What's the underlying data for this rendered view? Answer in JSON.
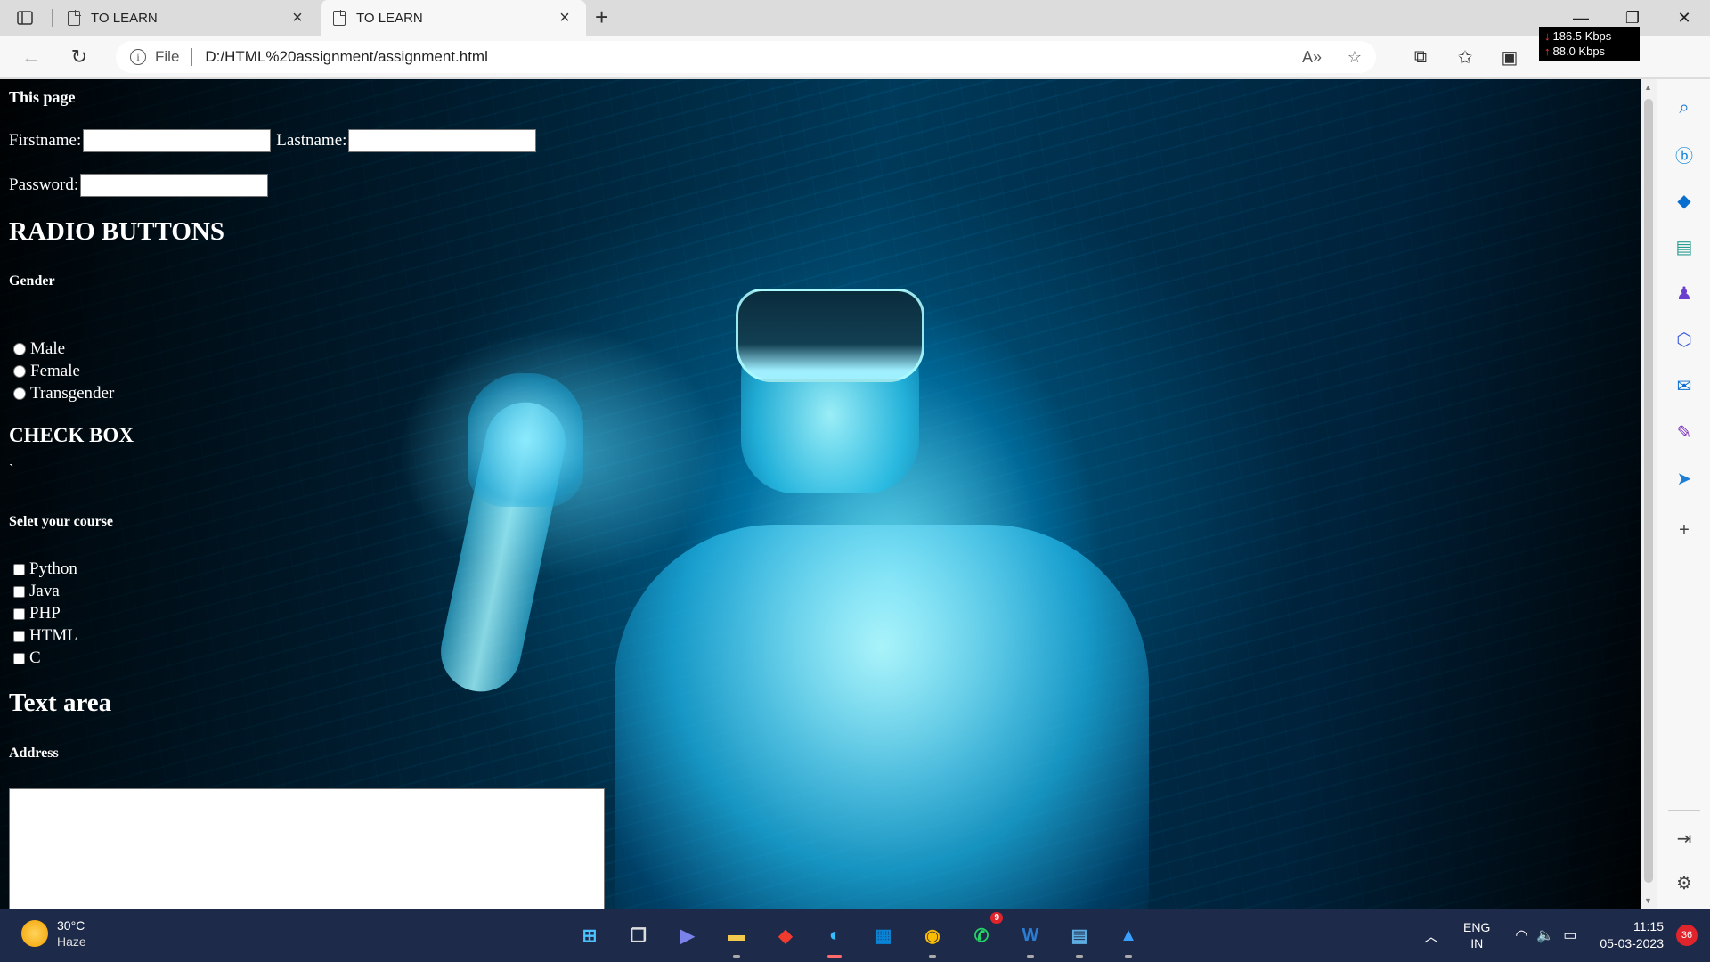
{
  "browser": {
    "tabs": [
      {
        "title": "TO LEARN",
        "active": false
      },
      {
        "title": "TO LEARN",
        "active": true
      }
    ],
    "address": {
      "scheme_label": "File",
      "url": "D:/HTML%20assignment/assignment.html"
    },
    "net_meter": {
      "down": "186.5 Kbps",
      "up": "88.0 Kbps"
    }
  },
  "page": {
    "title": "This page",
    "firstname_label": "Firstname:",
    "lastname_label": "Lastname:",
    "password_label": "Password:",
    "radio_heading": "RADIO BUTTONS",
    "gender_label": "Gender",
    "genders": [
      "Male",
      "Female",
      "Transgender"
    ],
    "checkbox_heading": "CHECK BOX",
    "stray_mark": "`",
    "course_label": "Selet your course",
    "courses": [
      "Python",
      "Java",
      "PHP",
      "HTML",
      "C"
    ],
    "textarea_heading": "Text area",
    "address_label": "Address"
  },
  "sidebar": {
    "items": [
      "search-icon",
      "bing-icon",
      "shopping-icon",
      "tools-icon",
      "games-icon",
      "office-icon",
      "outlook-icon",
      "designer-icon",
      "send-icon",
      "add-icon"
    ],
    "bottom": [
      "sidebar-toggle-icon",
      "settings-icon"
    ]
  },
  "taskbar": {
    "weather": {
      "temp": "30°C",
      "condition": "Haze"
    },
    "apps": [
      "start",
      "task-view",
      "teams-chat",
      "file-explorer",
      "anydesk",
      "edge",
      "store",
      "chrome",
      "whatsapp",
      "word",
      "notepad",
      "photos"
    ],
    "whatsapp_badge": "9",
    "lang": {
      "line1": "ENG",
      "line2": "IN"
    },
    "clock": {
      "time": "11:15",
      "date": "05-03-2023"
    },
    "notifications": "36"
  },
  "colors": {
    "accent": "#0a84d6",
    "taskbar": "#1d2a4a",
    "edge_active": "#ff6b6b"
  }
}
